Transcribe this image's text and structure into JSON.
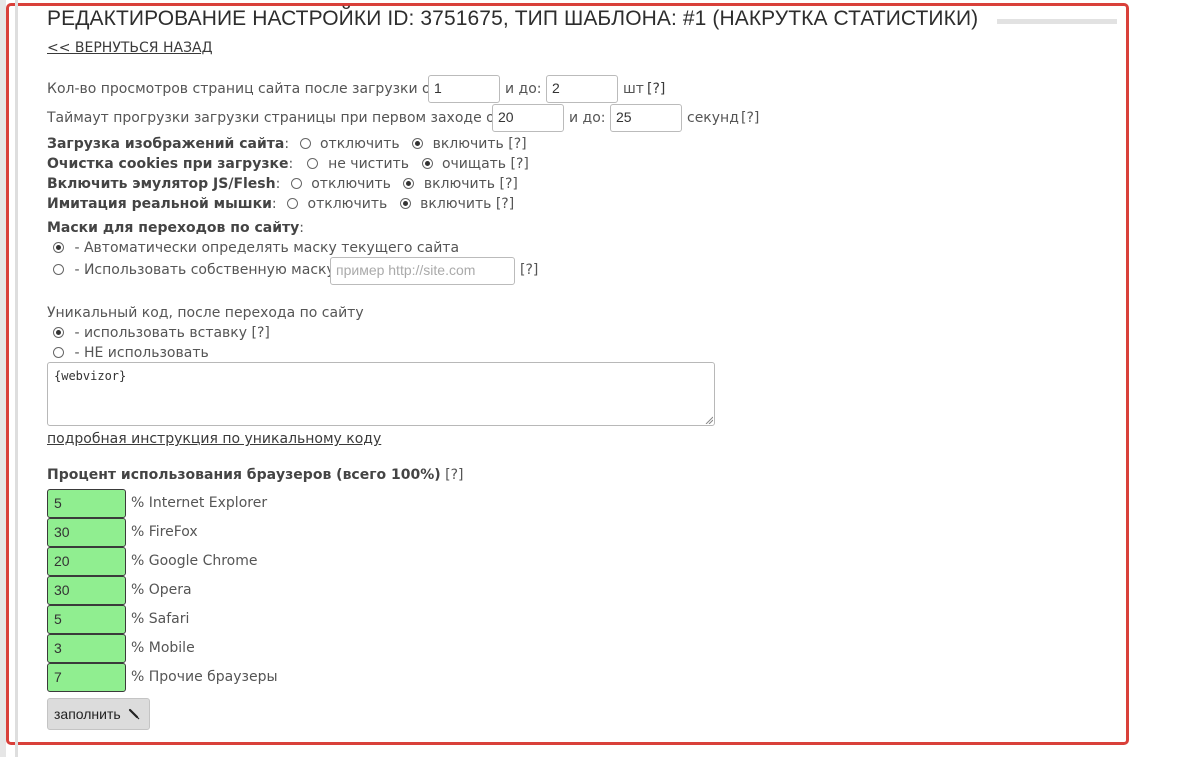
{
  "header": {
    "title": "РЕДАКТИРОВАНИЕ НАСТРОЙКИ ID: 3751675, ТИП ШАБЛОНА: #1 (НАКРУТКА СТАТИСТИКИ)",
    "back_link": "<< ВЕРНУТЬСЯ НАЗАД"
  },
  "page_views": {
    "label_from": "Кол-во просмотров страниц сайта после загрузки от",
    "from_value": "1",
    "label_to": "и до:",
    "to_value": "2",
    "unit": "шт",
    "help": "[?]"
  },
  "timeout": {
    "label_from": "Таймаут прогрузки загрузки страницы при первом заходе от",
    "from_value": "20",
    "label_to": "и до:",
    "to_value": "25",
    "unit": "секунд",
    "help": "[?]"
  },
  "options": [
    {
      "label": "Загрузка изображений сайта",
      "off": "отключить",
      "on": "включить",
      "selected": "on",
      "help": "[?]"
    },
    {
      "label": "Очистка cookies при загрузке",
      "off": "не чистить",
      "on": "очищать",
      "selected": "on",
      "help": "[?]"
    },
    {
      "label": "Включить эмулятор JS/Flesh",
      "off": "отключить",
      "on": "включить",
      "selected": "on",
      "help": "[?]"
    },
    {
      "label": "Имитация реальной мышки",
      "off": "отключить",
      "on": "включить",
      "selected": "on",
      "help": "[?]"
    }
  ],
  "masks": {
    "title": "Маски для переходов по сайту",
    "auto_label": "- Автоматически определять маску текущего сайта",
    "custom_label": "- Использовать собственную маску",
    "custom_placeholder": "пример http://site.com",
    "help": "[?]",
    "selected": "auto"
  },
  "unique_code": {
    "title": "Уникальный код, после перехода по сайту",
    "use_label": "- использовать вставку",
    "use_help": "[?]",
    "no_label": "- НЕ использовать",
    "selected": "use",
    "value": "{webvizor}",
    "instruction_link": "подробная инструкция по уникальному коду"
  },
  "browsers": {
    "title": "Процент использования браузеров (всего 100%)",
    "help": "[?]",
    "items": [
      {
        "value": "5",
        "label": "% Internet Explorer"
      },
      {
        "value": "30",
        "label": "% FireFox"
      },
      {
        "value": "20",
        "label": "% Google Chrome"
      },
      {
        "value": "30",
        "label": "% Opera"
      },
      {
        "value": "5",
        "label": "% Safari"
      },
      {
        "value": "3",
        "label": "% Mobile"
      },
      {
        "value": "7",
        "label": "% Прочие браузеры"
      }
    ],
    "field_color": "#90ee90"
  },
  "fill_button": {
    "label": "заполнить",
    "icon": "pencil-icon"
  },
  "colors": {
    "frame_border": "#d9403a"
  }
}
